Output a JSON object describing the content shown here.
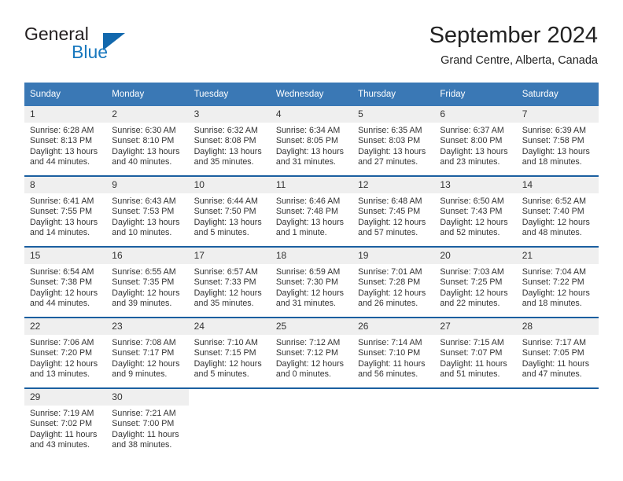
{
  "brand": {
    "name_part1": "General",
    "name_part2": "Blue",
    "logo_icon": "triangle-logo-icon"
  },
  "header": {
    "title": "September 2024",
    "subtitle": "Grand Centre, Alberta, Canada"
  },
  "colors": {
    "header_row_bg": "#3a78b5",
    "week_divider": "#1b5fa0",
    "daynum_bg": "#efefef",
    "brand_blue": "#1878be",
    "text": "#333333"
  },
  "weekday_headers": [
    "Sunday",
    "Monday",
    "Tuesday",
    "Wednesday",
    "Thursday",
    "Friday",
    "Saturday"
  ],
  "labels": {
    "sunrise": "Sunrise:",
    "sunset": "Sunset:",
    "daylight": "Daylight:"
  },
  "weeks": [
    [
      {
        "day": "1",
        "sunrise": "Sunrise: 6:28 AM",
        "sunset": "Sunset: 8:13 PM",
        "daylight1": "Daylight: 13 hours",
        "daylight2": "and 44 minutes."
      },
      {
        "day": "2",
        "sunrise": "Sunrise: 6:30 AM",
        "sunset": "Sunset: 8:10 PM",
        "daylight1": "Daylight: 13 hours",
        "daylight2": "and 40 minutes."
      },
      {
        "day": "3",
        "sunrise": "Sunrise: 6:32 AM",
        "sunset": "Sunset: 8:08 PM",
        "daylight1": "Daylight: 13 hours",
        "daylight2": "and 35 minutes."
      },
      {
        "day": "4",
        "sunrise": "Sunrise: 6:34 AM",
        "sunset": "Sunset: 8:05 PM",
        "daylight1": "Daylight: 13 hours",
        "daylight2": "and 31 minutes."
      },
      {
        "day": "5",
        "sunrise": "Sunrise: 6:35 AM",
        "sunset": "Sunset: 8:03 PM",
        "daylight1": "Daylight: 13 hours",
        "daylight2": "and 27 minutes."
      },
      {
        "day": "6",
        "sunrise": "Sunrise: 6:37 AM",
        "sunset": "Sunset: 8:00 PM",
        "daylight1": "Daylight: 13 hours",
        "daylight2": "and 23 minutes."
      },
      {
        "day": "7",
        "sunrise": "Sunrise: 6:39 AM",
        "sunset": "Sunset: 7:58 PM",
        "daylight1": "Daylight: 13 hours",
        "daylight2": "and 18 minutes."
      }
    ],
    [
      {
        "day": "8",
        "sunrise": "Sunrise: 6:41 AM",
        "sunset": "Sunset: 7:55 PM",
        "daylight1": "Daylight: 13 hours",
        "daylight2": "and 14 minutes."
      },
      {
        "day": "9",
        "sunrise": "Sunrise: 6:43 AM",
        "sunset": "Sunset: 7:53 PM",
        "daylight1": "Daylight: 13 hours",
        "daylight2": "and 10 minutes."
      },
      {
        "day": "10",
        "sunrise": "Sunrise: 6:44 AM",
        "sunset": "Sunset: 7:50 PM",
        "daylight1": "Daylight: 13 hours",
        "daylight2": "and 5 minutes."
      },
      {
        "day": "11",
        "sunrise": "Sunrise: 6:46 AM",
        "sunset": "Sunset: 7:48 PM",
        "daylight1": "Daylight: 13 hours",
        "daylight2": "and 1 minute."
      },
      {
        "day": "12",
        "sunrise": "Sunrise: 6:48 AM",
        "sunset": "Sunset: 7:45 PM",
        "daylight1": "Daylight: 12 hours",
        "daylight2": "and 57 minutes."
      },
      {
        "day": "13",
        "sunrise": "Sunrise: 6:50 AM",
        "sunset": "Sunset: 7:43 PM",
        "daylight1": "Daylight: 12 hours",
        "daylight2": "and 52 minutes."
      },
      {
        "day": "14",
        "sunrise": "Sunrise: 6:52 AM",
        "sunset": "Sunset: 7:40 PM",
        "daylight1": "Daylight: 12 hours",
        "daylight2": "and 48 minutes."
      }
    ],
    [
      {
        "day": "15",
        "sunrise": "Sunrise: 6:54 AM",
        "sunset": "Sunset: 7:38 PM",
        "daylight1": "Daylight: 12 hours",
        "daylight2": "and 44 minutes."
      },
      {
        "day": "16",
        "sunrise": "Sunrise: 6:55 AM",
        "sunset": "Sunset: 7:35 PM",
        "daylight1": "Daylight: 12 hours",
        "daylight2": "and 39 minutes."
      },
      {
        "day": "17",
        "sunrise": "Sunrise: 6:57 AM",
        "sunset": "Sunset: 7:33 PM",
        "daylight1": "Daylight: 12 hours",
        "daylight2": "and 35 minutes."
      },
      {
        "day": "18",
        "sunrise": "Sunrise: 6:59 AM",
        "sunset": "Sunset: 7:30 PM",
        "daylight1": "Daylight: 12 hours",
        "daylight2": "and 31 minutes."
      },
      {
        "day": "19",
        "sunrise": "Sunrise: 7:01 AM",
        "sunset": "Sunset: 7:28 PM",
        "daylight1": "Daylight: 12 hours",
        "daylight2": "and 26 minutes."
      },
      {
        "day": "20",
        "sunrise": "Sunrise: 7:03 AM",
        "sunset": "Sunset: 7:25 PM",
        "daylight1": "Daylight: 12 hours",
        "daylight2": "and 22 minutes."
      },
      {
        "day": "21",
        "sunrise": "Sunrise: 7:04 AM",
        "sunset": "Sunset: 7:22 PM",
        "daylight1": "Daylight: 12 hours",
        "daylight2": "and 18 minutes."
      }
    ],
    [
      {
        "day": "22",
        "sunrise": "Sunrise: 7:06 AM",
        "sunset": "Sunset: 7:20 PM",
        "daylight1": "Daylight: 12 hours",
        "daylight2": "and 13 minutes."
      },
      {
        "day": "23",
        "sunrise": "Sunrise: 7:08 AM",
        "sunset": "Sunset: 7:17 PM",
        "daylight1": "Daylight: 12 hours",
        "daylight2": "and 9 minutes."
      },
      {
        "day": "24",
        "sunrise": "Sunrise: 7:10 AM",
        "sunset": "Sunset: 7:15 PM",
        "daylight1": "Daylight: 12 hours",
        "daylight2": "and 5 minutes."
      },
      {
        "day": "25",
        "sunrise": "Sunrise: 7:12 AM",
        "sunset": "Sunset: 7:12 PM",
        "daylight1": "Daylight: 12 hours",
        "daylight2": "and 0 minutes."
      },
      {
        "day": "26",
        "sunrise": "Sunrise: 7:14 AM",
        "sunset": "Sunset: 7:10 PM",
        "daylight1": "Daylight: 11 hours",
        "daylight2": "and 56 minutes."
      },
      {
        "day": "27",
        "sunrise": "Sunrise: 7:15 AM",
        "sunset": "Sunset: 7:07 PM",
        "daylight1": "Daylight: 11 hours",
        "daylight2": "and 51 minutes."
      },
      {
        "day": "28",
        "sunrise": "Sunrise: 7:17 AM",
        "sunset": "Sunset: 7:05 PM",
        "daylight1": "Daylight: 11 hours",
        "daylight2": "and 47 minutes."
      }
    ],
    [
      {
        "day": "29",
        "sunrise": "Sunrise: 7:19 AM",
        "sunset": "Sunset: 7:02 PM",
        "daylight1": "Daylight: 11 hours",
        "daylight2": "and 43 minutes."
      },
      {
        "day": "30",
        "sunrise": "Sunrise: 7:21 AM",
        "sunset": "Sunset: 7:00 PM",
        "daylight1": "Daylight: 11 hours",
        "daylight2": "and 38 minutes."
      },
      {
        "day": "",
        "sunrise": "",
        "sunset": "",
        "daylight1": "",
        "daylight2": ""
      },
      {
        "day": "",
        "sunrise": "",
        "sunset": "",
        "daylight1": "",
        "daylight2": ""
      },
      {
        "day": "",
        "sunrise": "",
        "sunset": "",
        "daylight1": "",
        "daylight2": ""
      },
      {
        "day": "",
        "sunrise": "",
        "sunset": "",
        "daylight1": "",
        "daylight2": ""
      },
      {
        "day": "",
        "sunrise": "",
        "sunset": "",
        "daylight1": "",
        "daylight2": ""
      }
    ]
  ]
}
